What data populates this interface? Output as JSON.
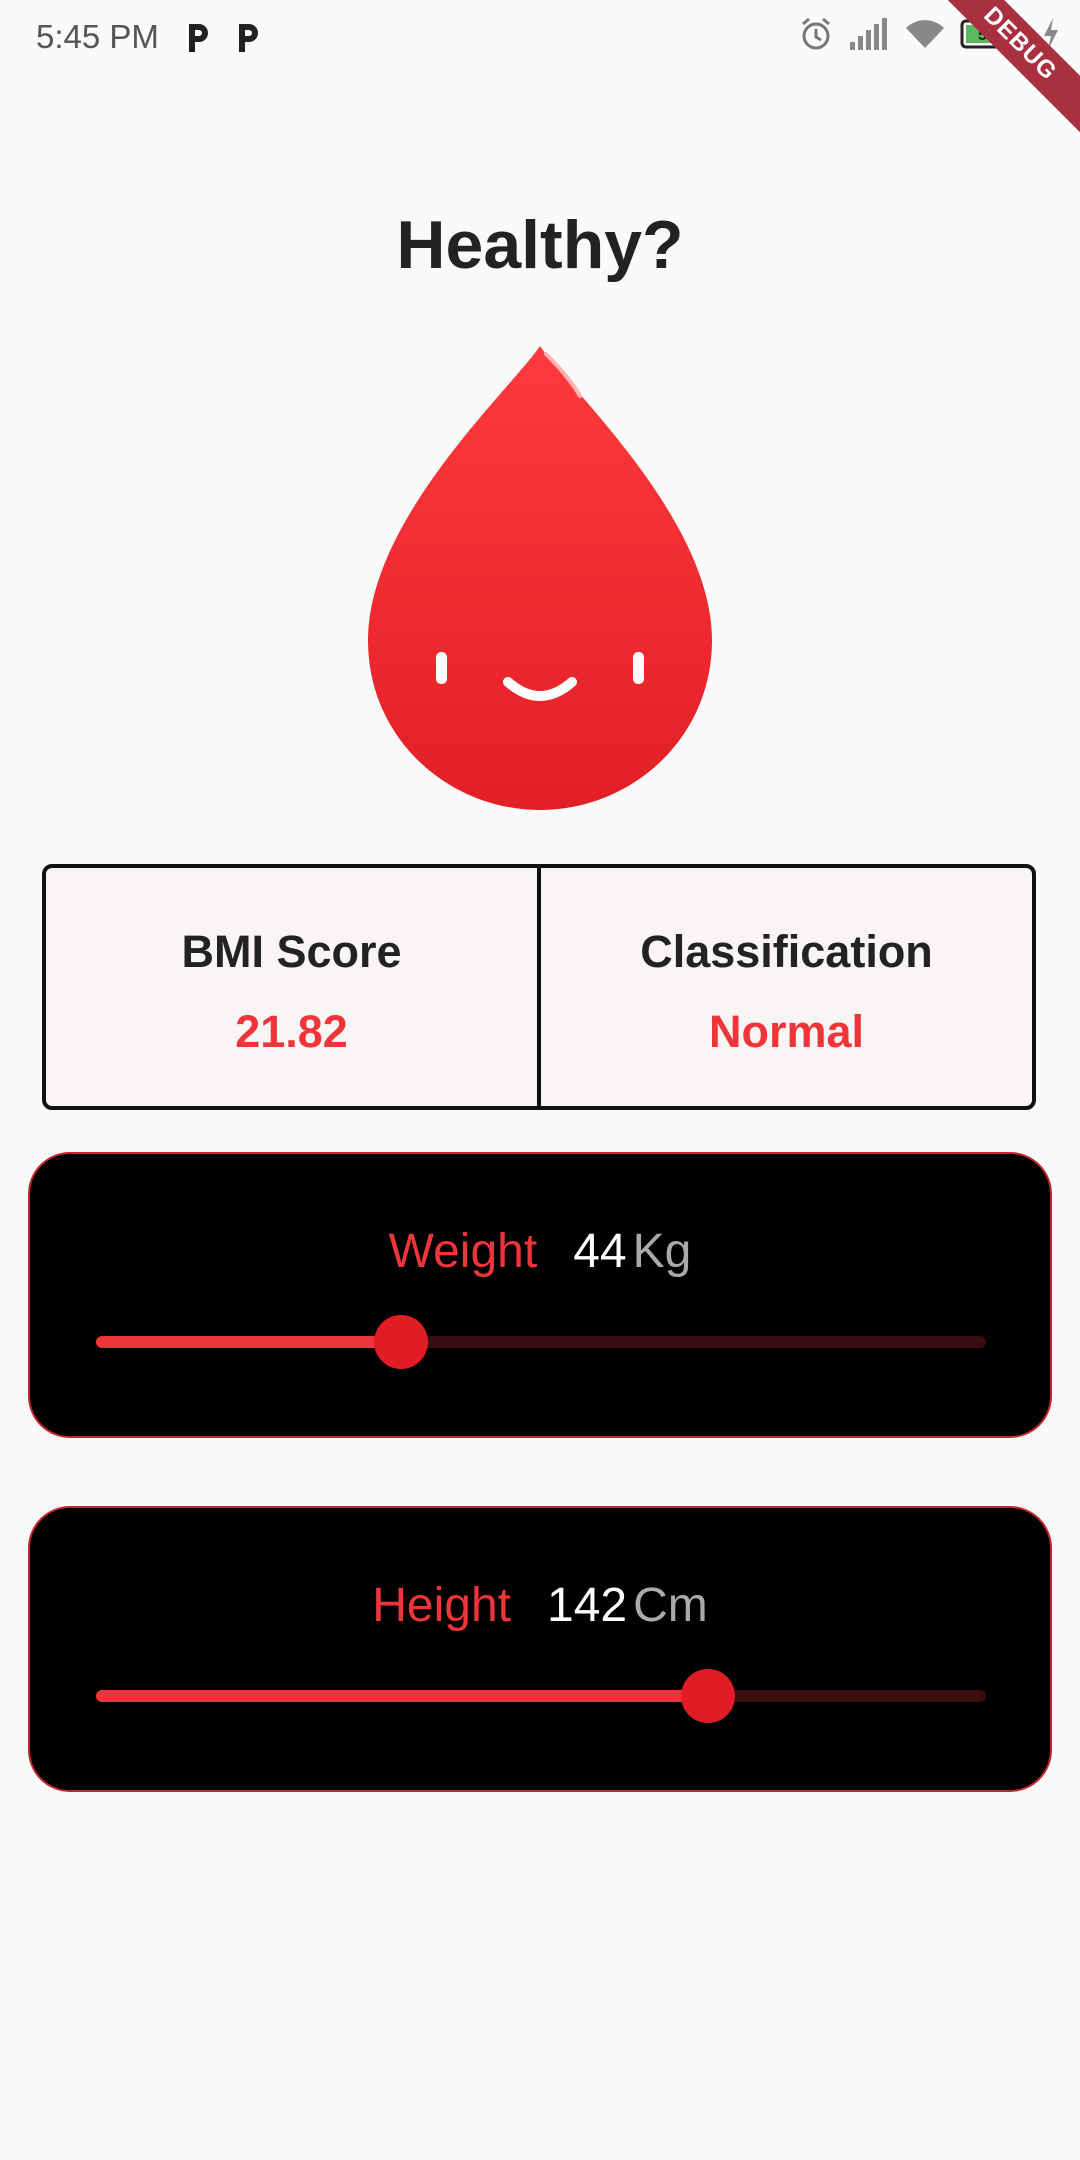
{
  "status_bar": {
    "time": "5:45 PM",
    "battery": "51"
  },
  "debug_banner": "DEBUG",
  "page": {
    "title": "Healthy?"
  },
  "result": {
    "bmi_label": "BMI Score",
    "bmi_value": "21.82",
    "class_label": "Classification",
    "class_value": "Normal"
  },
  "weight": {
    "label": "Weight",
    "value": "44",
    "unit": "Kg",
    "slider_fraction": 0.343
  },
  "height": {
    "label": "Height",
    "value": "142",
    "unit": "Cm",
    "slider_fraction": 0.688
  },
  "colors": {
    "accent": "#f0353a",
    "thumb": "#e21c25",
    "card_bg": "#000000",
    "page_bg": "#fafafa"
  }
}
